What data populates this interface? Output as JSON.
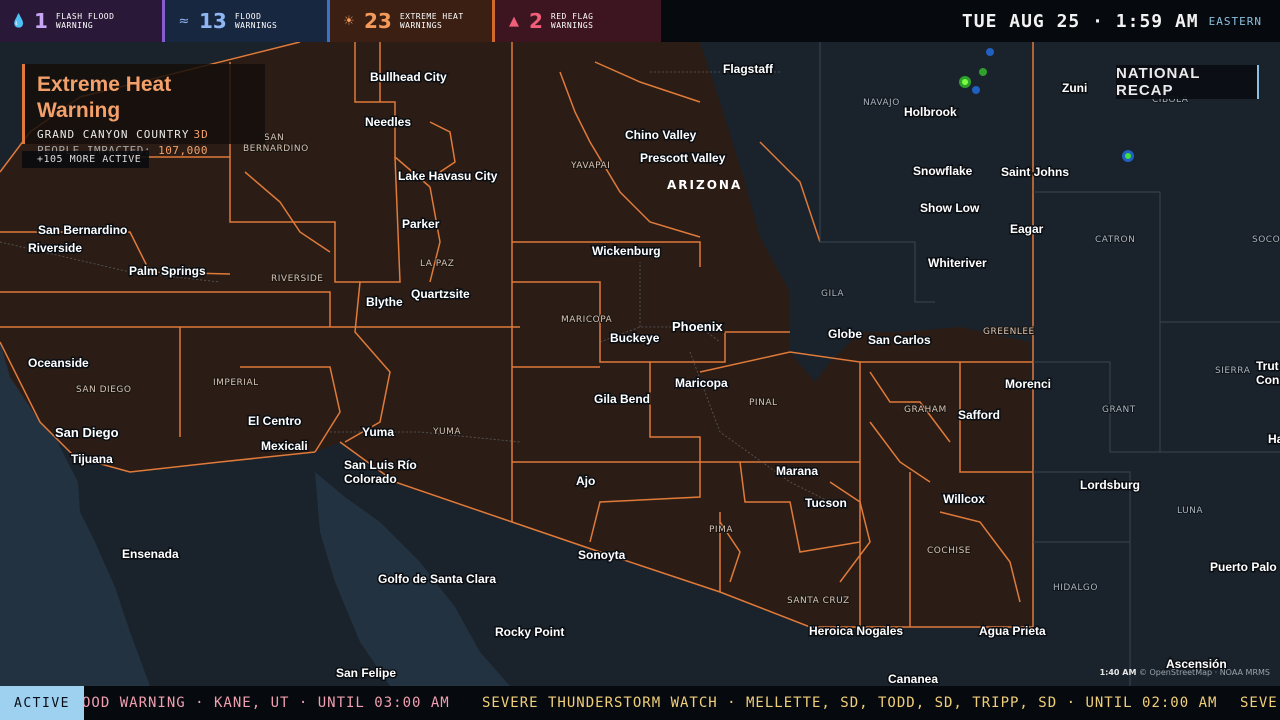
{
  "top_alerts": [
    {
      "icon": "droplet-icon",
      "count": "1",
      "line1": "FLASH FLOOD",
      "line2": "WARNING",
      "color": "#c7a6f5"
    },
    {
      "icon": "waves-icon",
      "count": "13",
      "line1": "FLOOD",
      "line2": "WARNINGS",
      "color": "#8fb6f3"
    },
    {
      "icon": "sun-icon",
      "count": "23",
      "line1": "EXTREME HEAT",
      "line2": "WARNINGS",
      "color": "#f39a5a"
    },
    {
      "icon": "warning-triangle-icon",
      "count": "2",
      "line1": "RED FLAG",
      "line2": "WARNINGS",
      "color": "#f05e7a"
    }
  ],
  "clock": {
    "time": "TUE AUG 25 · 1:59 AM",
    "timezone": "EASTERN"
  },
  "feature_card": {
    "title": "Extreme Heat Warning",
    "area": "GRAND CANYON COUNTRY",
    "duration": "3D",
    "impacted_label": "PEOPLE IMPACTED:",
    "impacted_value": "107,000"
  },
  "more_active": "+105 MORE ACTIVE",
  "recap_button": "NATIONAL RECAP",
  "map": {
    "state_label": "ARIZONA",
    "cities": [
      "Flagstaff",
      "Holbrook",
      "Zuni",
      "Bullhead City",
      "Needles",
      "Lake Havasu City",
      "Chino Valley",
      "Prescott Valley",
      "Snowflake",
      "Saint Johns",
      "Show Low",
      "Eagar",
      "Parker",
      "San Bernardino",
      "Riverside",
      "Palm Springs",
      "Wickenburg",
      "Whiteriver",
      "Blythe",
      "Quartzsite",
      "Phoenix",
      "Buckeye",
      "Globe",
      "San Carlos",
      "Oceanside",
      "Maricopa",
      "Morenci",
      "Gila Bend",
      "Safford",
      "El Centro",
      "Yuma",
      "San Diego",
      "Mexicali",
      "Tijuana",
      "San Luis Río",
      "Colorado",
      "Marana",
      "Ajo",
      "Tucson",
      "Willcox",
      "Lordsburg",
      "Sonoyta",
      "Ensenada",
      "Golfo de Santa Clara",
      "Puerto Palo",
      "Rocky Point",
      "Heroica Nogales",
      "Agua Prieta",
      "San Felipe",
      "Cananea",
      "Ascensión",
      "Trut",
      "Cons",
      "Ha"
    ],
    "counties": [
      "NAVAJO",
      "CIBOLA",
      "SAN",
      "BERNARDINO",
      "YAVAPAI",
      "CATRON",
      "SOCO",
      "RIVERSIDE",
      "LA PAZ",
      "GILA",
      "MARICOPA",
      "GREENLEE",
      "IMPERIAL",
      "SAN DIEGO",
      "SIERRA",
      "PINAL",
      "GRAHAM",
      "GRANT",
      "YUMA",
      "PIMA",
      "LUNA",
      "COCHISE",
      "HIDALGO",
      "SANTA CRUZ"
    ]
  },
  "attribution": {
    "time": "1:40 AM",
    "text": "© OpenStreetMap · NOAA MRMS"
  },
  "ticker": {
    "active_label": "ACTIVE",
    "items": [
      "OOD WARNING · KANE, UT · UNTIL 03:00 AM",
      "SEVERE THUNDERSTORM WATCH · MELLETTE, SD, TODD, SD, TRIPP, SD · UNTIL 02:00 AM",
      "SEVE"
    ]
  },
  "colors": {
    "heat_outline": "#e07a3a",
    "heat_fill": "#2b1d15",
    "background": "#0f151c"
  }
}
